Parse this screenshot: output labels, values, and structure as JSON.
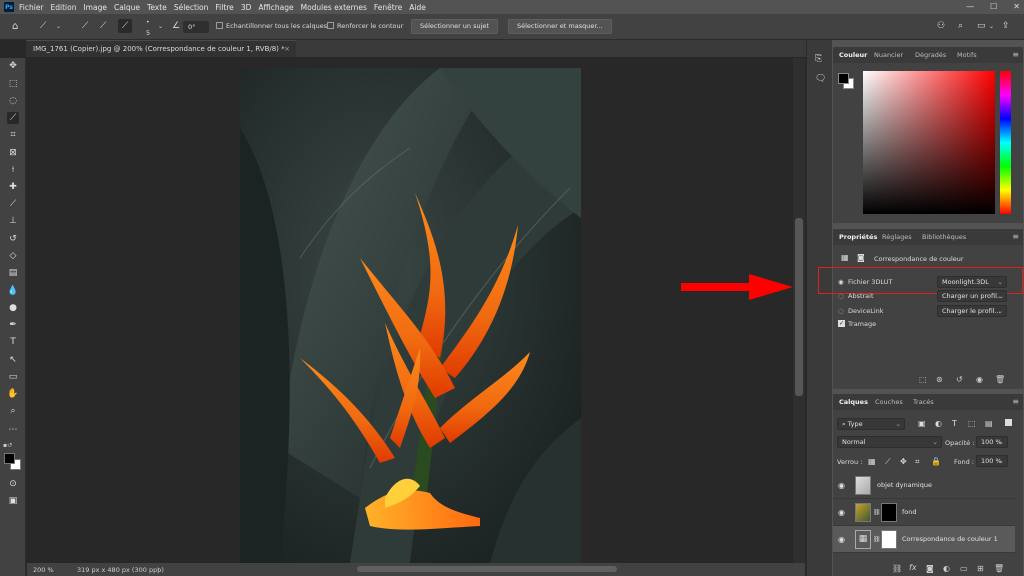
{
  "app": {
    "logo": "Ps"
  },
  "menu": [
    "Fichier",
    "Edition",
    "Image",
    "Calque",
    "Texte",
    "Sélection",
    "Filtre",
    "3D",
    "Affichage",
    "Modules externes",
    "Fenêtre",
    "Aide"
  ],
  "window_controls": {
    "minimize": "—",
    "maximize": "☐",
    "close": "✕"
  },
  "options_bar": {
    "brush_size": "5",
    "angle": "0°",
    "sample_all_layers": "Echantillonner tous les calques",
    "enhance_edge": "Renforcer le contour",
    "select_subject": "Sélectionner un sujet",
    "select_and_mask": "Sélectionner et masquer..."
  },
  "document": {
    "tab_title": "IMG_1761 (Copier).jpg @ 200% (Correspondance de couleur 1, RVB/8) *",
    "close": "×",
    "zoom": "200 %",
    "dimensions": "319 px x 480 px (300 ppp)"
  },
  "color_panel": {
    "tabs": [
      "Couleur",
      "Nuancier",
      "Dégradés",
      "Motifs"
    ],
    "foreground": "#000000",
    "background": "#ffffff",
    "hue": "#ff0000"
  },
  "properties_panel": {
    "tabs": [
      "Propriétés",
      "Réglages",
      "Bibliothèques"
    ],
    "header": "Correspondance de couleur",
    "options": [
      {
        "label": "Fichier 3DLUT",
        "value": "Moonlight.3DL",
        "selected": true
      },
      {
        "label": "Abstrait",
        "value": "Charger un profil...",
        "selected": false
      },
      {
        "label": "DeviceLink",
        "value": "Charger le profil...",
        "selected": false
      }
    ],
    "dither": "Tramage"
  },
  "layers_panel": {
    "tabs": [
      "Calques",
      "Couches",
      "Tracés"
    ],
    "filter": "Type",
    "blend_mode": "Normal",
    "opacity_label": "Opacité :",
    "opacity": "100 %",
    "lock_label": "Verrou :",
    "fill_label": "Fond :",
    "fill": "100 %",
    "layers": [
      {
        "name": "objet dynamique",
        "selected": false
      },
      {
        "name": "fond",
        "selected": false
      },
      {
        "name": "Correspondance de couleur 1",
        "selected": true
      }
    ],
    "bottom_icons": [
      "link-icon",
      "fx-icon",
      "mask-icon",
      "adjustment-icon",
      "group-icon",
      "new-layer-icon",
      "trash-icon"
    ]
  },
  "annotations": {
    "arrow_color": "#ff0000",
    "highlight_color": "#e02020"
  }
}
